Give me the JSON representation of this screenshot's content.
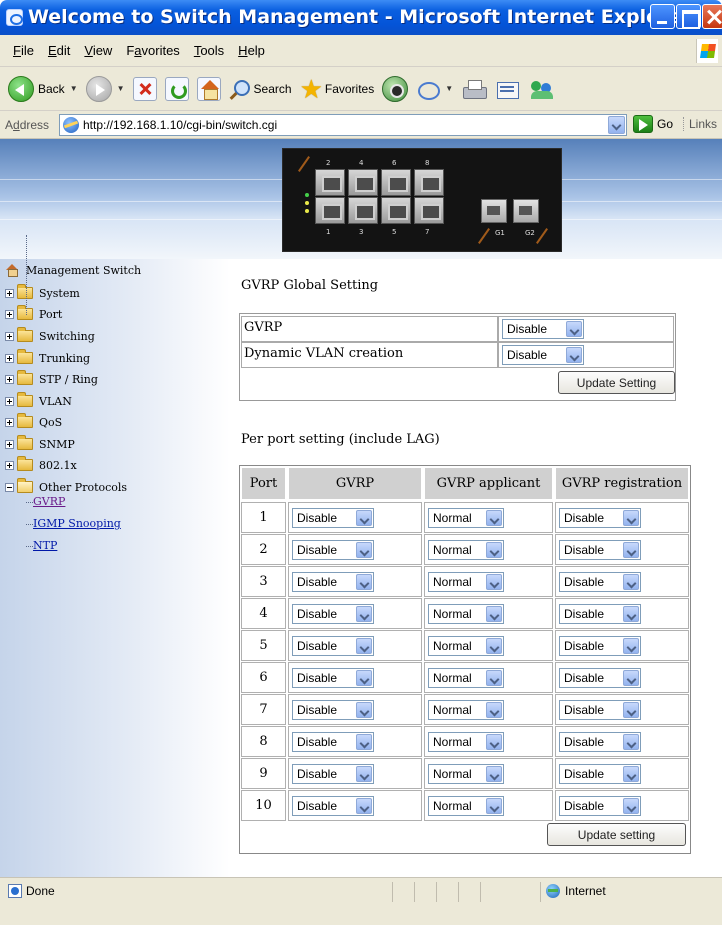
{
  "window": {
    "title": "Welcome to Switch Management - Microsoft Internet Explorer"
  },
  "menu": {
    "items": [
      {
        "ul": "F",
        "rest": "ile"
      },
      {
        "ul": "E",
        "rest": "dit"
      },
      {
        "ul": "V",
        "rest": "iew"
      },
      {
        "pre": "F",
        "ul": "a",
        "rest": "vorites"
      },
      {
        "ul": "T",
        "rest": "ools"
      },
      {
        "ul": "H",
        "rest": "elp"
      }
    ]
  },
  "toolbar": {
    "back_label": "Back",
    "search_label": "Search",
    "favorites_label": "Favorites"
  },
  "address": {
    "label_ul": "d",
    "label_pre": "A",
    "label_rest": "dress",
    "url": "http://192.168.1.10/cgi-bin/switch.cgi",
    "go_label": "Go",
    "links_label": "Links"
  },
  "banner": {
    "port_labels_top": [
      "2",
      "4",
      "6",
      "8"
    ],
    "port_labels_bottom": [
      "1",
      "3",
      "5",
      "7"
    ],
    "sfp_labels": [
      "G1",
      "G2"
    ]
  },
  "sidebar": {
    "root": "Management Switch",
    "folders": [
      "System",
      "Port",
      "Switching",
      "Trunking",
      "STP / Ring",
      "VLAN",
      "QoS",
      "SNMP",
      "802.1x"
    ],
    "open_folder": "Other Protocols",
    "children": [
      "GVRP",
      "IGMP Snooping",
      "NTP"
    ]
  },
  "global": {
    "title": "GVRP Global Setting",
    "rows": [
      {
        "label": "GVRP",
        "value": "Disable"
      },
      {
        "label": "Dynamic VLAN creation",
        "value": "Disable"
      }
    ],
    "update_button": "Update Setting"
  },
  "perport": {
    "title": "Per port setting (include LAG)",
    "headers": [
      "Port",
      "GVRP",
      "GVRP applicant",
      "GVRP registration"
    ],
    "rows": [
      {
        "port": "1",
        "gvrp": "Disable",
        "applicant": "Normal",
        "registration": "Disable"
      },
      {
        "port": "2",
        "gvrp": "Disable",
        "applicant": "Normal",
        "registration": "Disable"
      },
      {
        "port": "3",
        "gvrp": "Disable",
        "applicant": "Normal",
        "registration": "Disable"
      },
      {
        "port": "4",
        "gvrp": "Disable",
        "applicant": "Normal",
        "registration": "Disable"
      },
      {
        "port": "5",
        "gvrp": "Disable",
        "applicant": "Normal",
        "registration": "Disable"
      },
      {
        "port": "6",
        "gvrp": "Disable",
        "applicant": "Normal",
        "registration": "Disable"
      },
      {
        "port": "7",
        "gvrp": "Disable",
        "applicant": "Normal",
        "registration": "Disable"
      },
      {
        "port": "8",
        "gvrp": "Disable",
        "applicant": "Normal",
        "registration": "Disable"
      },
      {
        "port": "9",
        "gvrp": "Disable",
        "applicant": "Normal",
        "registration": "Disable"
      },
      {
        "port": "10",
        "gvrp": "Disable",
        "applicant": "Normal",
        "registration": "Disable"
      }
    ],
    "update_button": "Update setting"
  },
  "status": {
    "text": "Done",
    "zone": "Internet"
  }
}
